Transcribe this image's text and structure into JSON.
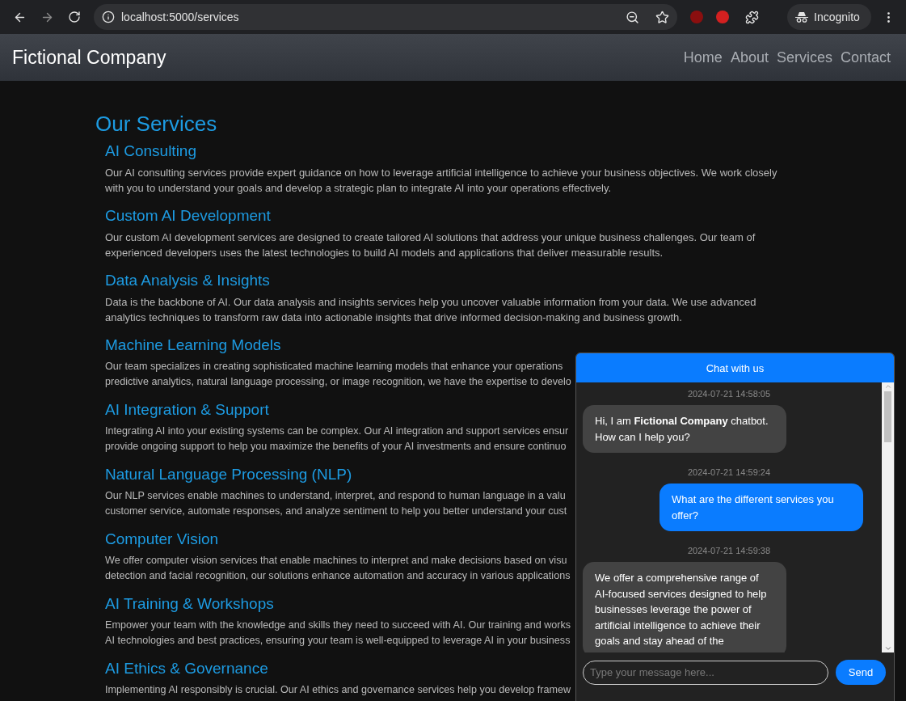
{
  "browser": {
    "url": "localhost:5000/services",
    "profile": "Incognito"
  },
  "navbar": {
    "brand": "Fictional Company",
    "links": [
      "Home",
      "About",
      "Services",
      "Contact"
    ]
  },
  "page": {
    "title": "Our Services",
    "sections": [
      {
        "heading": "AI Consulting",
        "lines": [
          "Our AI consulting services provide expert guidance on how to leverage artificial intelligence to achieve your business objectives. We work closely with you to understand your goals and develop a strategic plan to integrate AI into your operations effectively."
        ]
      },
      {
        "heading": "Custom AI Development",
        "lines": [
          "Our custom AI development services are designed to create tailored AI solutions that address your unique business challenges. Our team of experienced developers uses the latest technologies to build AI models and applications that deliver measurable results."
        ]
      },
      {
        "heading": "Data Analysis & Insights",
        "lines": [
          "Data is the backbone of AI. Our data analysis and insights services help you uncover valuable information from your data. We use advanced analytics techniques to transform raw data into actionable insights that drive informed decision-making and business growth."
        ]
      },
      {
        "heading": "Machine Learning Models",
        "lines": [
          "Our team specializes in creating sophisticated machine learning models that enhance your operations",
          "predictive analytics, natural language processing, or image recognition, we have the expertise to develo"
        ]
      },
      {
        "heading": "AI Integration & Support",
        "lines": [
          "Integrating AI into your existing systems can be complex. Our AI integration and support services ensur",
          "provide ongoing support to help you maximize the benefits of your AI investments and ensure continuo"
        ]
      },
      {
        "heading": "Natural Language Processing (NLP)",
        "lines": [
          "Our NLP services enable machines to understand, interpret, and respond to human language in a valu",
          "customer service, automate responses, and analyze sentiment to help you better understand your cust"
        ]
      },
      {
        "heading": "Computer Vision",
        "lines": [
          "We offer computer vision services that enable machines to interpret and make decisions based on visu",
          "detection and facial recognition, our solutions enhance automation and accuracy in various applications"
        ]
      },
      {
        "heading": "AI Training & Workshops",
        "lines": [
          "Empower your team with the knowledge and skills they need to succeed with AI. Our training and works",
          "AI technologies and best practices, ensuring your team is well-equipped to leverage AI in your business"
        ]
      },
      {
        "heading": "AI Ethics & Governance",
        "lines": [
          "Implementing AI responsibly is crucial. Our AI ethics and governance services help you develop framew"
        ]
      }
    ]
  },
  "chat": {
    "title": "Chat with us",
    "messages": [
      {
        "kind": "bot",
        "time": "2024-07-21 14:58:05",
        "text": "Hi, I am **Fictional Company** chatbot. How can I help you?"
      },
      {
        "kind": "user",
        "time": "2024-07-21 14:59:24",
        "text": "What are the different services you offer?"
      },
      {
        "kind": "bot",
        "time": "2024-07-21 14:59:38",
        "text": "We offer a comprehensive range of AI-focused services designed to help businesses leverage the power of artificial intelligence to achieve their goals and stay ahead of the"
      }
    ],
    "input": {
      "placeholder": "Type your message here..."
    },
    "send": "Send"
  }
}
